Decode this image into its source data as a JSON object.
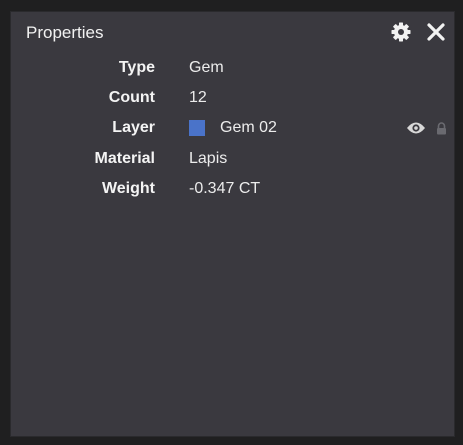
{
  "panel": {
    "title": "Properties",
    "settings_icon": "gear-icon",
    "close_icon": "close-icon"
  },
  "properties": {
    "type": {
      "label": "Type",
      "value": "Gem"
    },
    "count": {
      "label": "Count",
      "value": "12"
    },
    "layer": {
      "label": "Layer",
      "value": "Gem 02",
      "color": "#4a73c9",
      "visibility_icon": "eye-icon",
      "lock_icon": "lock-icon"
    },
    "material": {
      "label": "Material",
      "value": "Lapis"
    },
    "weight": {
      "label": "Weight",
      "value": "-0.347 CT"
    }
  },
  "colors": {
    "panel_background": "#3a393f",
    "outer_background": "#1f1f20",
    "text": "#f2f2f2"
  }
}
